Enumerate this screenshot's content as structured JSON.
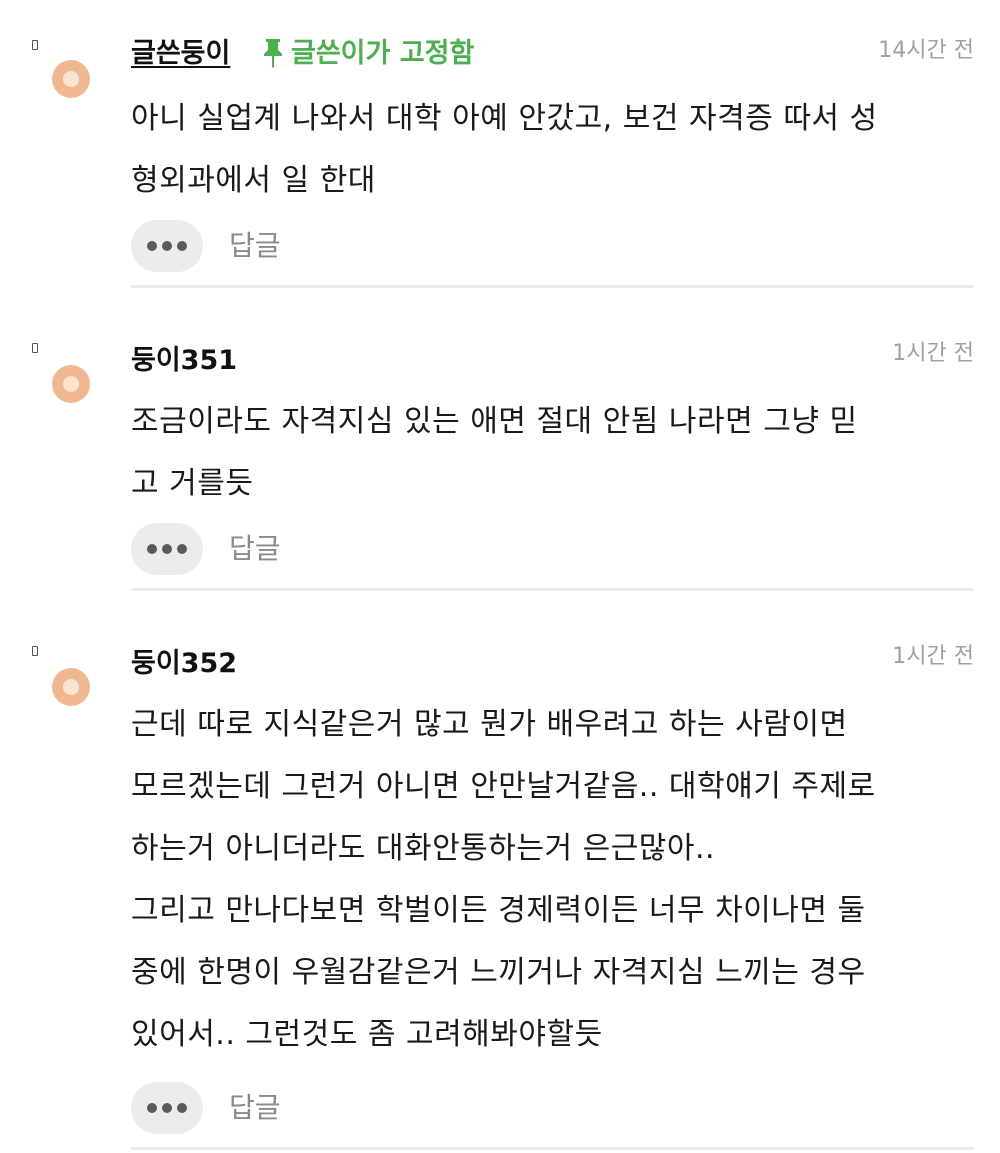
{
  "comments": [
    {
      "author": "글쓴둥이",
      "pinned_label": "글쓴이가 고정함",
      "time": "14시간 전",
      "lines": [
        "아니 실업계 나와서 대학 아예 안갔고, 보건 자격증 따서 성",
        "형외과에서 일 한대"
      ],
      "reply_label": "답글"
    },
    {
      "author": "둥이351",
      "time": "1시간 전",
      "lines": [
        "조금이라도 자격지심 있는 애면 절대 안됨 나라면 그냥 믿",
        "고 거를듯"
      ],
      "reply_label": "답글"
    },
    {
      "author": "둥이352",
      "time": "1시간 전",
      "lines": [
        "근데 따로 지식같은거 많고 뭔가 배우려고 하는 사람이면",
        "모르겠는데 그런거 아니면 안만날거같음.. 대학얘기 주제로",
        "하는거 아니더라도 대화안통하는거 은근많아..",
        "그리고 만나다보면 학벌이든 경제력이든 너무 차이나면 둘",
        "중에 한명이 우월감같은거 느끼거나 자격지심 느끼는 경우",
        "있어서.. 그런것도 좀 고려해봐야할듯"
      ],
      "reply_label": "답글"
    }
  ],
  "icons": {
    "pin": "pin-icon",
    "more": "more-dots-icon",
    "avatar": "avatar-icon"
  },
  "colors": {
    "pinned_green": "#4caf50",
    "avatar_orange": "#f0b891",
    "time_gray": "#a0a0a0",
    "button_bg": "#ececec"
  }
}
